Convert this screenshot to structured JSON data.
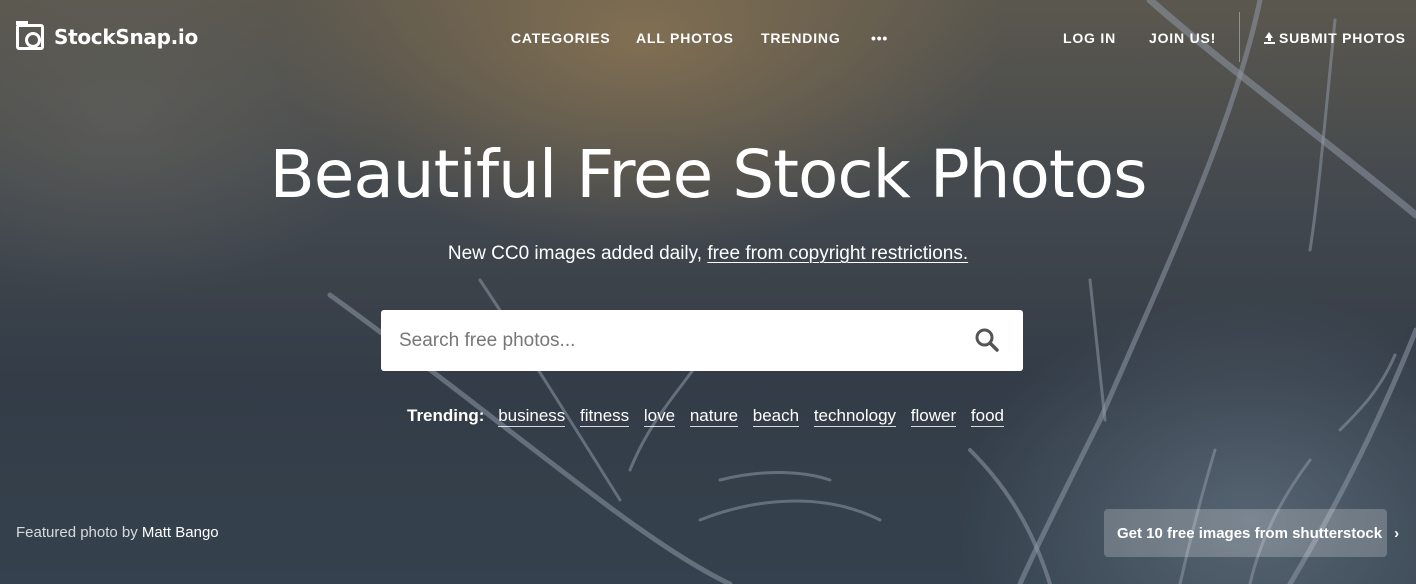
{
  "brand": {
    "name": "StockSnap.io"
  },
  "nav": {
    "categories": "CATEGORIES",
    "all_photos": "ALL PHOTOS",
    "trending": "TRENDING",
    "more": "•••",
    "log_in": "LOG IN",
    "join_us": "JOIN US!",
    "submit_photos": "SUBMIT PHOTOS"
  },
  "hero": {
    "title": "Beautiful Free Stock Photos",
    "subtitle_prefix": "New CC0 images added daily, ",
    "subtitle_link": "free from copyright restrictions.",
    "search_placeholder": "Search free photos..."
  },
  "trending": {
    "label": "Trending:",
    "tags": [
      "business",
      "fitness",
      "love",
      "nature",
      "beach",
      "technology",
      "flower",
      "food"
    ]
  },
  "credit": {
    "prefix": "Featured photo by ",
    "author": "Matt Bango"
  },
  "promo": {
    "label": "Get 10 free images from shutterstock",
    "arrow": "›"
  },
  "icons": {
    "logo": "camera-icon",
    "search": "search-icon",
    "upload": "upload-icon"
  },
  "colors": {
    "text": "#ffffff",
    "search_bg": "#ffffff",
    "search_icon": "#555555"
  }
}
